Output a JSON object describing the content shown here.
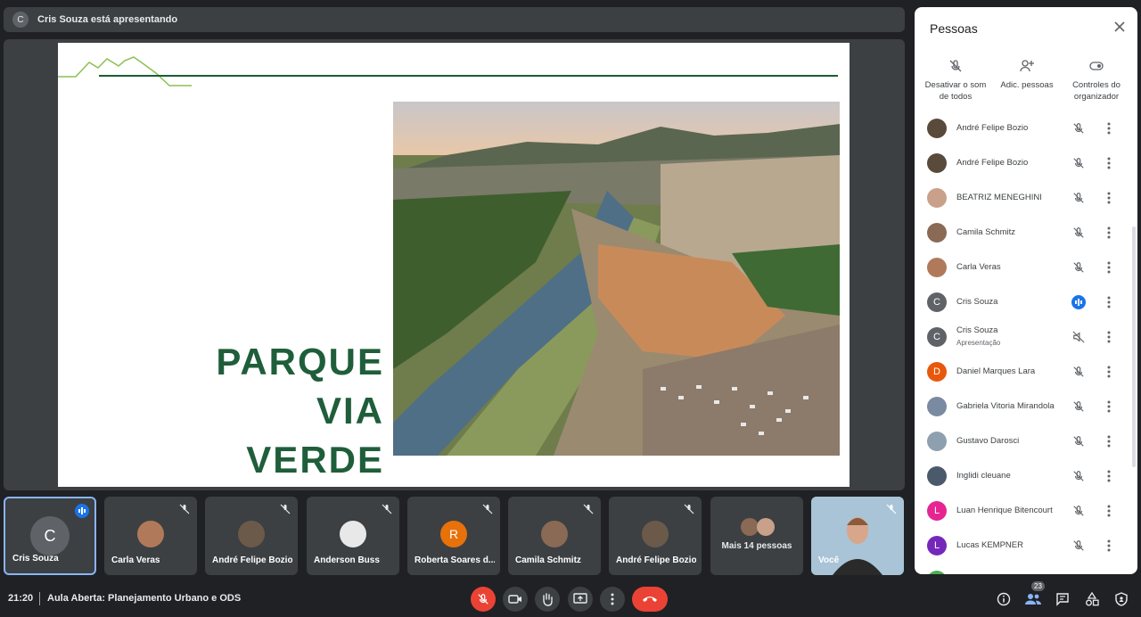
{
  "banner": {
    "avatar_letter": "C",
    "text": "Cris Souza está apresentando"
  },
  "slide": {
    "title_lines": [
      "PARQUE",
      "VIA",
      "VERDE"
    ]
  },
  "strip": [
    {
      "name": "Cris Souza",
      "avatar_letter": "C",
      "avatar_color": "#5f6368",
      "speaking": true
    },
    {
      "name": "Carla Veras",
      "avatar_color": "#b07a5a"
    },
    {
      "name": "André Felipe Bozio",
      "avatar_color": "#6b5a4a"
    },
    {
      "name": "Anderson Buss",
      "avatar_color": "#e8e8e8"
    },
    {
      "name": "Roberta Soares d...",
      "avatar_letter": "R",
      "avatar_color": "#e8710a"
    },
    {
      "name": "Camila Schmitz",
      "avatar_color": "#8a6a55"
    },
    {
      "name": "André Felipe Bozio",
      "avatar_color": "#6b5a4a"
    },
    {
      "more_label": "Mais 14 pessoas"
    },
    {
      "name": "Você"
    }
  ],
  "panel": {
    "title": "Pessoas",
    "actions": [
      {
        "label": "Desativar o som de todos",
        "icon": "mic-off-icon"
      },
      {
        "label": "Adic. pessoas",
        "icon": "add-person-icon"
      },
      {
        "label": "Controles do organizador",
        "icon": "toggle-icon"
      }
    ],
    "people": [
      {
        "name": "André Felipe Bozio",
        "avatar_color": "#5a4a3c"
      },
      {
        "name": "André Felipe Bozio",
        "avatar_color": "#5a4a3c"
      },
      {
        "name": "BEATRIZ MENEGHINI",
        "avatar_color": "#c9a08a"
      },
      {
        "name": "Camila Schmitz",
        "avatar_color": "#8a6a55"
      },
      {
        "name": "Carla Veras",
        "avatar_color": "#b07a5a"
      },
      {
        "name": "Cris Souza",
        "avatar_letter": "C",
        "avatar_color": "#5f6368",
        "speaking": true
      },
      {
        "name": "Cris Souza",
        "sub": "Apresentação",
        "avatar_letter": "C",
        "avatar_color": "#5f6368",
        "presenting": true
      },
      {
        "name": "Daniel Marques Lara",
        "avatar_letter": "D",
        "avatar_color": "#e8580c"
      },
      {
        "name": "Gabriela Vitoria Mirandola",
        "avatar_color": "#7a8aa0"
      },
      {
        "name": "Gustavo Darosci",
        "avatar_color": "#8ea0b0"
      },
      {
        "name": "Inglidi cleuane",
        "avatar_color": "#4a5a6a"
      },
      {
        "name": "Luan Henrique Bitencourt",
        "avatar_letter": "L",
        "avatar_color": "#e52592"
      },
      {
        "name": "Lucas KEMPNER",
        "avatar_letter": "L",
        "avatar_color": "#7627bb"
      }
    ]
  },
  "bottom": {
    "time": "21:20",
    "meeting_name": "Aula Aberta: Planejamento Urbano e ODS",
    "participants_count": "23"
  }
}
